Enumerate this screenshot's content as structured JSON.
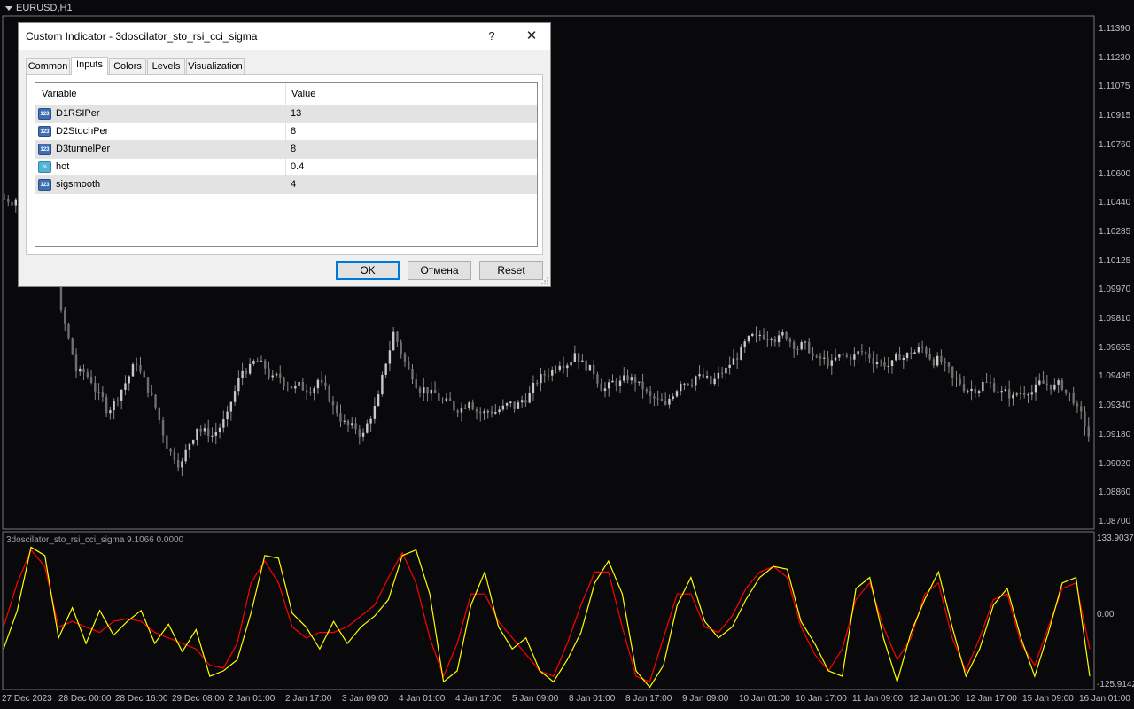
{
  "chart": {
    "symbol": "EURUSD,H1",
    "price_ticks": [
      "1.11390",
      "1.11230",
      "1.11075",
      "1.10915",
      "1.10760",
      "1.10600",
      "1.10440",
      "1.10285",
      "1.10125",
      "1.09970",
      "1.09810",
      "1.09655",
      "1.09495",
      "1.09340",
      "1.09180",
      "1.09020",
      "1.08860",
      "1.08700"
    ],
    "time_ticks": [
      "27 Dec 2023",
      "28 Dec 00:00",
      "28 Dec 16:00",
      "29 Dec 08:00",
      "2 Jan 01:00",
      "2 Jan 17:00",
      "3 Jan 09:00",
      "4 Jan 01:00",
      "4 Jan 17:00",
      "5 Jan 09:00",
      "8 Jan 01:00",
      "8 Jan 17:00",
      "9 Jan 09:00",
      "10 Jan 01:00",
      "10 Jan 17:00",
      "11 Jan 09:00",
      "12 Jan 01:00",
      "12 Jan 17:00",
      "15 Jan 09:00",
      "16 Jan 01:00"
    ],
    "price_series": [
      1.1047,
      1.106,
      1.1055,
      1.0985,
      1.0955,
      1.095,
      1.0935,
      1.0945,
      1.096,
      1.094,
      1.0915,
      1.0905,
      1.0925,
      1.092,
      1.093,
      1.0955,
      1.096,
      1.095,
      1.0948,
      1.0946,
      1.095,
      1.0935,
      1.0925,
      1.092,
      1.094,
      1.0975,
      1.0955,
      1.0945,
      1.094,
      1.0935,
      1.094,
      1.0932,
      1.0934,
      1.0936,
      1.0942,
      1.0953,
      1.096,
      1.0965,
      1.0955,
      1.0945,
      1.0948,
      1.095,
      1.094,
      1.0935,
      1.095,
      1.0952,
      1.0948,
      1.0955,
      1.0965,
      1.0972,
      1.0975,
      1.0974,
      1.0968,
      1.096,
      1.0958,
      1.0962,
      1.0965,
      1.096,
      1.0958,
      1.0963,
      1.0967,
      1.096,
      1.095,
      1.0945,
      1.0948,
      1.0945,
      1.094,
      1.0945,
      1.0948,
      1.0947,
      1.094,
      1.092
    ],
    "indicator": {
      "label": "3doscilator_sto_rsi_cci_sigma 9.1066 0.0000",
      "ticks": [
        "133.9037",
        "0.00",
        "-125.9142"
      ],
      "yellow_color": "#ffff00",
      "red_color": "#ff0000",
      "yellow": [
        -60,
        10,
        125,
        110,
        -40,
        15,
        -50,
        10,
        -35,
        -10,
        10,
        -50,
        -15,
        -65,
        -25,
        -110,
        -100,
        -80,
        5,
        110,
        105,
        5,
        -20,
        -60,
        -10,
        -50,
        -20,
        0,
        30,
        110,
        120,
        40,
        -120,
        -100,
        20,
        80,
        -20,
        -60,
        -40,
        -100,
        -120,
        -80,
        -30,
        60,
        100,
        40,
        -100,
        -130,
        -90,
        20,
        70,
        -10,
        -40,
        -20,
        30,
        70,
        90,
        85,
        -10,
        -50,
        -100,
        -110,
        50,
        70,
        -40,
        -120,
        -30,
        30,
        80,
        -20,
        -110,
        -60,
        20,
        50,
        -40,
        -110,
        -30,
        60,
        70,
        -110
      ],
      "red": [
        -20,
        60,
        120,
        90,
        -20,
        -10,
        -20,
        -30,
        -10,
        -5,
        -10,
        -30,
        -40,
        -50,
        -60,
        -90,
        -95,
        -50,
        60,
        100,
        60,
        -20,
        -40,
        -30,
        -30,
        -20,
        0,
        20,
        70,
        115,
        60,
        -40,
        -110,
        -50,
        40,
        40,
        -10,
        -40,
        -70,
        -100,
        -110,
        -50,
        20,
        80,
        80,
        -20,
        -110,
        -120,
        -40,
        40,
        40,
        -20,
        -30,
        0,
        50,
        80,
        90,
        70,
        -20,
        -70,
        -100,
        -60,
        30,
        60,
        -20,
        -80,
        -40,
        40,
        60,
        -40,
        -100,
        -40,
        30,
        40,
        -50,
        -90,
        -20,
        50,
        60,
        -60
      ]
    }
  },
  "dialog": {
    "title": "Custom Indicator - 3doscilator_sto_rsi_cci_sigma",
    "help": "?",
    "close": "✕",
    "tabs": [
      "Common",
      "Inputs",
      "Colors",
      "Levels",
      "Visualization"
    ],
    "active_tab": "Inputs",
    "columns": {
      "variable": "Variable",
      "value": "Value"
    },
    "rows": [
      {
        "icon": "123",
        "type": "int",
        "name": "D1RSIPer",
        "value": "13"
      },
      {
        "icon": "123",
        "type": "int",
        "name": "D2StochPer",
        "value": "8"
      },
      {
        "icon": "123",
        "type": "int",
        "name": "D3tunnelPer",
        "value": "8"
      },
      {
        "icon": "½",
        "type": "dbl",
        "name": "hot",
        "value": "0.4"
      },
      {
        "icon": "123",
        "type": "int",
        "name": "sigsmooth",
        "value": "4"
      }
    ],
    "buttons": {
      "ok": "OK",
      "cancel": "Отмена",
      "reset": "Reset"
    }
  }
}
